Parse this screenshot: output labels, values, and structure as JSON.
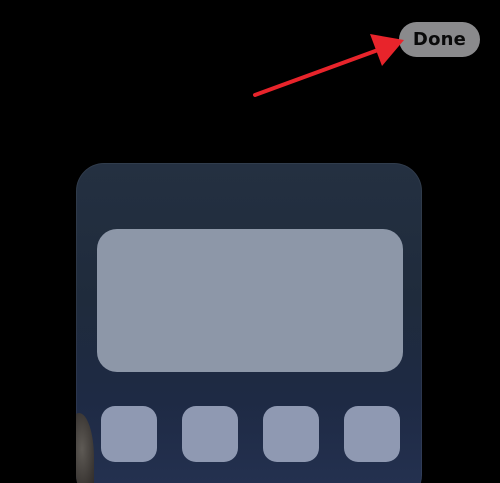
{
  "header": {
    "done_label": "Done"
  },
  "annotation": {
    "arrow_color": "#e8242b",
    "type": "red-arrow-pointing-to-done"
  },
  "preview": {
    "background_color": "#243041",
    "widget_color": "#8d97a8",
    "icon_color": "#8f99b2",
    "icon_count": 4
  }
}
